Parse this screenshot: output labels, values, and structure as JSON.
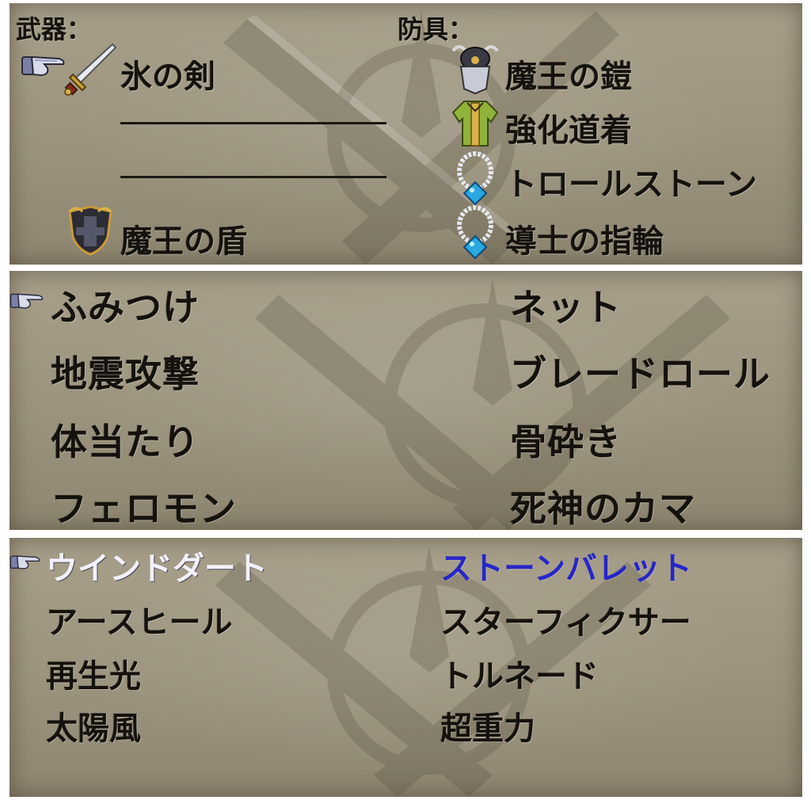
{
  "equipment": {
    "weapons_label": "武器：",
    "armor_label": "防具：",
    "weapons": [
      {
        "name": "氷の剣",
        "icon": "sword-icon"
      },
      {
        "name": "",
        "icon": ""
      },
      {
        "name": "",
        "icon": ""
      },
      {
        "name": "魔王の盾",
        "icon": "shield-icon"
      }
    ],
    "armor": [
      {
        "name": "魔王の鎧",
        "icon": "armor-icon"
      },
      {
        "name": "強化道着",
        "icon": "robe-icon"
      },
      {
        "name": "トロールストーン",
        "icon": "necklace-icon"
      },
      {
        "name": "導士の指輪",
        "icon": "necklace-icon"
      }
    ]
  },
  "skills": {
    "left": [
      "ふみつけ",
      "地震攻撃",
      "体当たり",
      "フェロモン"
    ],
    "right": [
      "ネット",
      "ブレードロール",
      "骨砕き",
      "死神のカマ"
    ]
  },
  "spells": {
    "left": [
      "ウインドダート",
      "アースヒール",
      "再生光",
      "太陽風"
    ],
    "right": [
      "ストーンバレット",
      "スターフィクサー",
      "トルネード",
      "超重力"
    ],
    "selected_color": "#f4f1ff",
    "highlight_color": "#2626c8"
  },
  "colors": {
    "panel_bg": "#9b937d",
    "text": "#15120d"
  }
}
